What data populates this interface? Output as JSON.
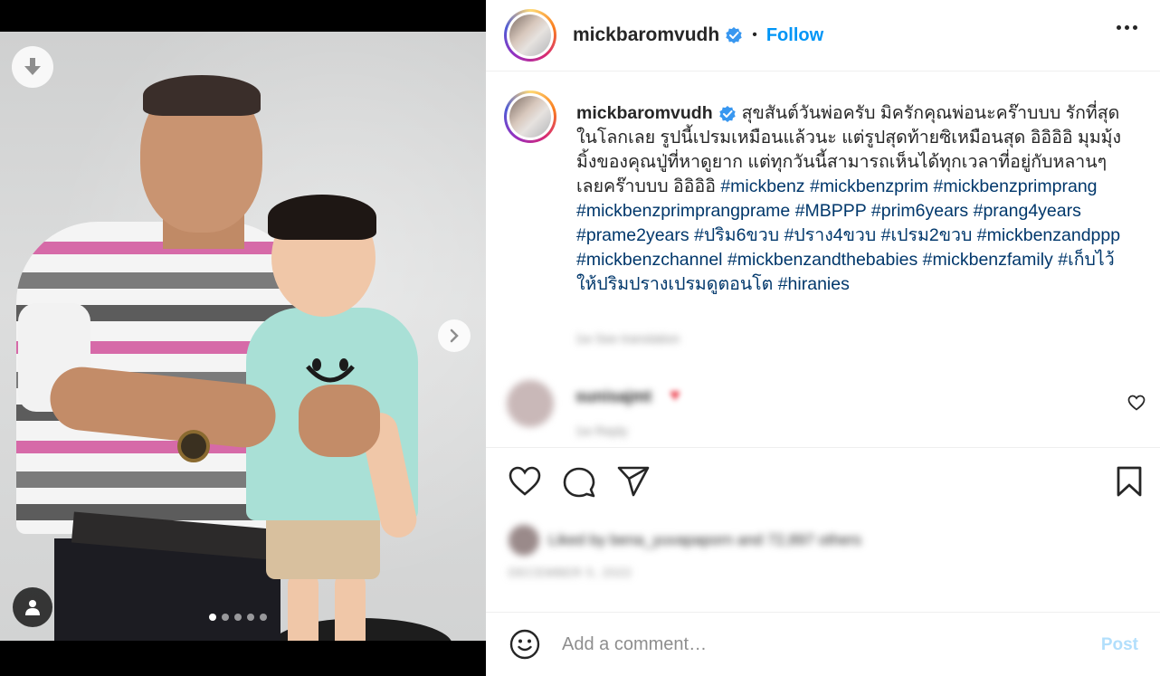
{
  "post": {
    "username": "mickbaromvudh",
    "separator": "•",
    "follow_label": "Follow",
    "caption_text": "สุขสันต์วันพ่อครับ มิครักคุณพ่อนะคร๊าบบบ รักที่สุดในโลกเลย รูปนี้เปรมเหมือนแล้วนะ แต่รูปสุดท้ายซิเหมือนสุด อิอิอิอิ มุมมุ้งมิ้งของคุณปู่ที่หาดูยาก แต่ทุกวันนี้สามารถเห็นได้ทุกเวลาที่อยู่กับหลานๆเลยคร๊าบบบ อิอิอิอิ ",
    "hashtags": [
      "#mickbenz",
      "#mickbenzprim",
      "#mickbenzprimprang",
      "#mickbenzprimprangprame",
      "#MBPPP",
      "#prim6years",
      "#prang4years",
      "#prame2years",
      "#ปริม6ขวบ",
      "#ปราง4ขวบ",
      "#เปรม2ขวบ",
      "#mickbenzandppp",
      "#mickbenzchannel",
      "#mickbenzandthebabies",
      "#mickbenzfamily",
      "#เก็บไว้ให้ปริมปรางเปรมดูตอนโต",
      "#hiranies"
    ],
    "caption_meta": "1w  See translation"
  },
  "comment": {
    "username": "sunisajmt",
    "heart": "♥",
    "meta": "1w   Reply"
  },
  "likes": {
    "text": "Liked by bena_yuvapaporn and 72,897 others"
  },
  "date": "DECEMBER 5, 2022",
  "composer": {
    "placeholder": "Add a comment…",
    "post_label": "Post"
  },
  "carousel": {
    "slide_count": 5,
    "active_index": 0
  },
  "colors": {
    "accent": "#0095f6",
    "hashtag": "#00376b",
    "post_disabled": "#b2dffc"
  }
}
